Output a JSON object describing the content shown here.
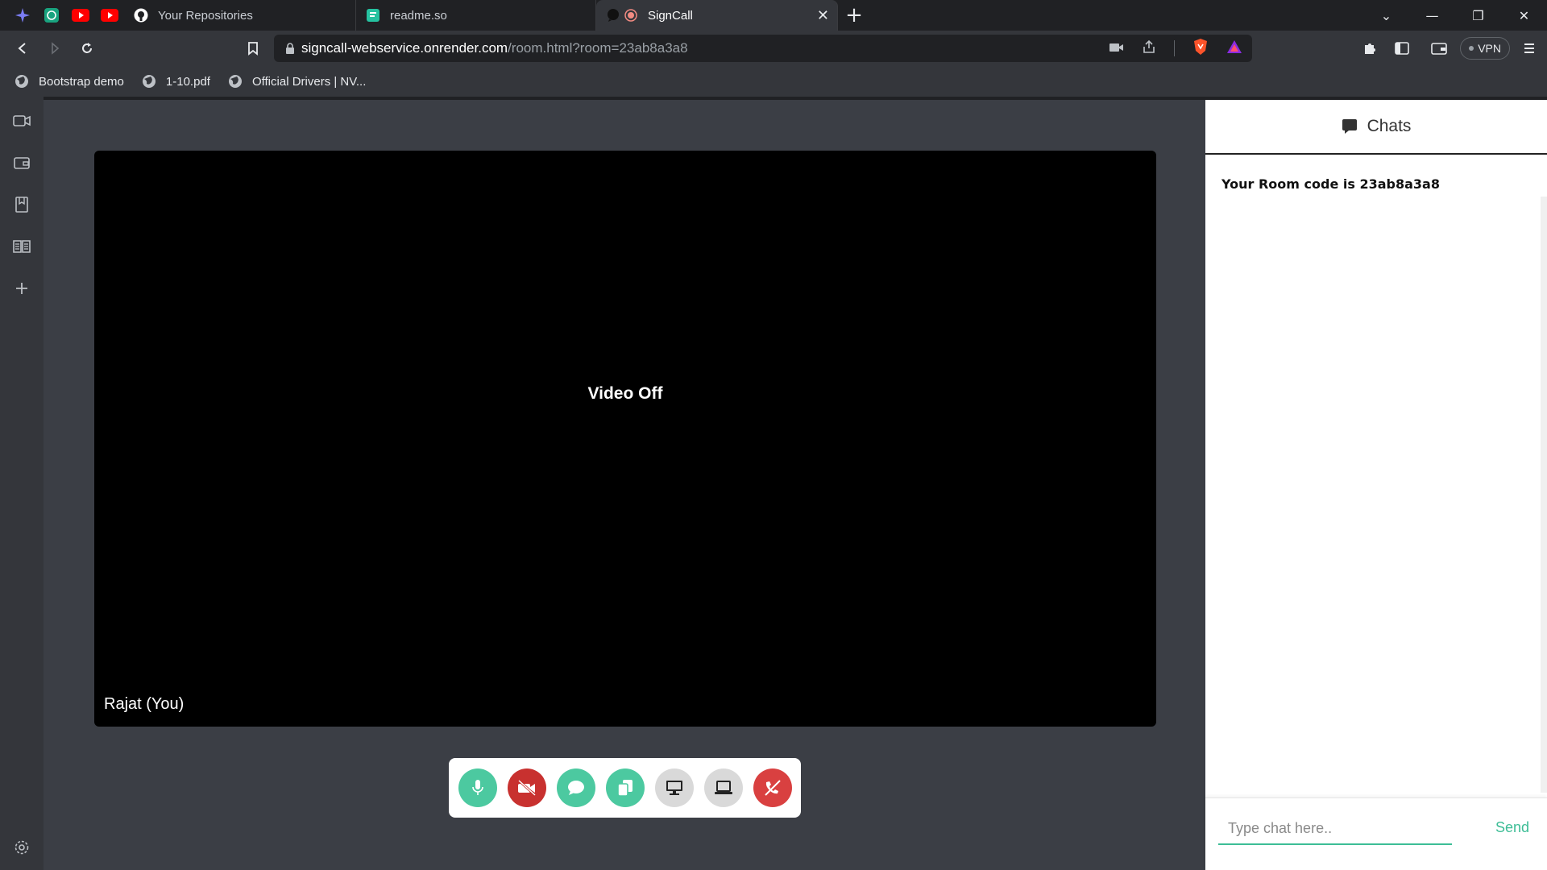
{
  "tabs": {
    "pinned": [
      {
        "icon": "sparkle-icon"
      },
      {
        "icon": "chatgpt-icon"
      },
      {
        "icon": "youtube-icon"
      },
      {
        "icon": "youtube-icon"
      }
    ],
    "items": [
      {
        "label": "Your Repositories",
        "icon": "github-icon"
      },
      {
        "label": "readme.so",
        "icon": "readme-icon"
      },
      {
        "label": "SignCall",
        "icon": "signcall-icon",
        "active": true
      }
    ]
  },
  "address": {
    "host": "signcall-webservice.onrender.com",
    "path": "/room.html?room=23ab8a3a8"
  },
  "toolbar": {
    "vpn_label": "VPN"
  },
  "bookmarks": [
    {
      "label": "Bootstrap demo"
    },
    {
      "label": "1-10.pdf"
    },
    {
      "label": "Official Drivers | NV..."
    }
  ],
  "video": {
    "status": "Video Off",
    "participant": "Rajat (You)"
  },
  "controls": [
    {
      "name": "mic-button",
      "color": "#4cc9a0"
    },
    {
      "name": "camera-off-button",
      "color": "#c8312f"
    },
    {
      "name": "chat-button",
      "color": "#4cc9a0"
    },
    {
      "name": "copy-room-button",
      "color": "#4cc9a0"
    },
    {
      "name": "screen-share-button",
      "color": "#d9d9d9"
    },
    {
      "name": "whiteboard-button",
      "color": "#d9d9d9"
    },
    {
      "name": "end-call-button",
      "color": "#d94040"
    }
  ],
  "chat": {
    "title": "Chats",
    "message": "Your Room code is 23ab8a3a8",
    "input_placeholder": "Type chat here..",
    "send_label": "Send"
  },
  "colors": {
    "accent": "#3dbd96"
  }
}
